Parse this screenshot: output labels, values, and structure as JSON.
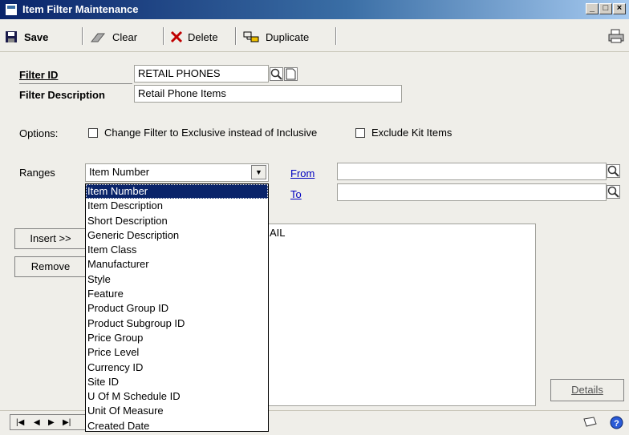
{
  "window": {
    "title": "Item Filter Maintenance"
  },
  "toolbar": {
    "save": "Save",
    "clear": "Clear",
    "delete": "Delete",
    "duplicate": "Duplicate"
  },
  "form": {
    "filter_id_label": "Filter ID",
    "filter_id_value": "RETAIL PHONES",
    "filter_desc_label": "Filter Description",
    "filter_desc_value": "Retail Phone Items",
    "options_label": "Options:",
    "option_exclusive": "Change Filter to Exclusive instead of Inclusive",
    "option_exclude_kit": "Exclude Kit Items",
    "ranges_label": "Ranges",
    "ranges_selected": "Item Number",
    "from_label": "From",
    "to_label": "To",
    "insert_button": "Insert >>",
    "remove_button": "Remove",
    "list_partial_text": "AIL",
    "details_button": "Details"
  },
  "dropdown_options": [
    "Item Number",
    "Item Description",
    "Short Description",
    "Generic Description",
    "Item Class",
    "Manufacturer",
    "Style",
    "Feature",
    "Product Group ID",
    "Product Subgroup ID",
    "Price Group",
    "Price Level",
    "Currency ID",
    "Site ID",
    "U Of M Schedule ID",
    "Unit Of Measure",
    "Created Date"
  ],
  "colors": {
    "title_bar": "#0a246a",
    "link": "#0000c0",
    "selection": "#0a246a"
  }
}
